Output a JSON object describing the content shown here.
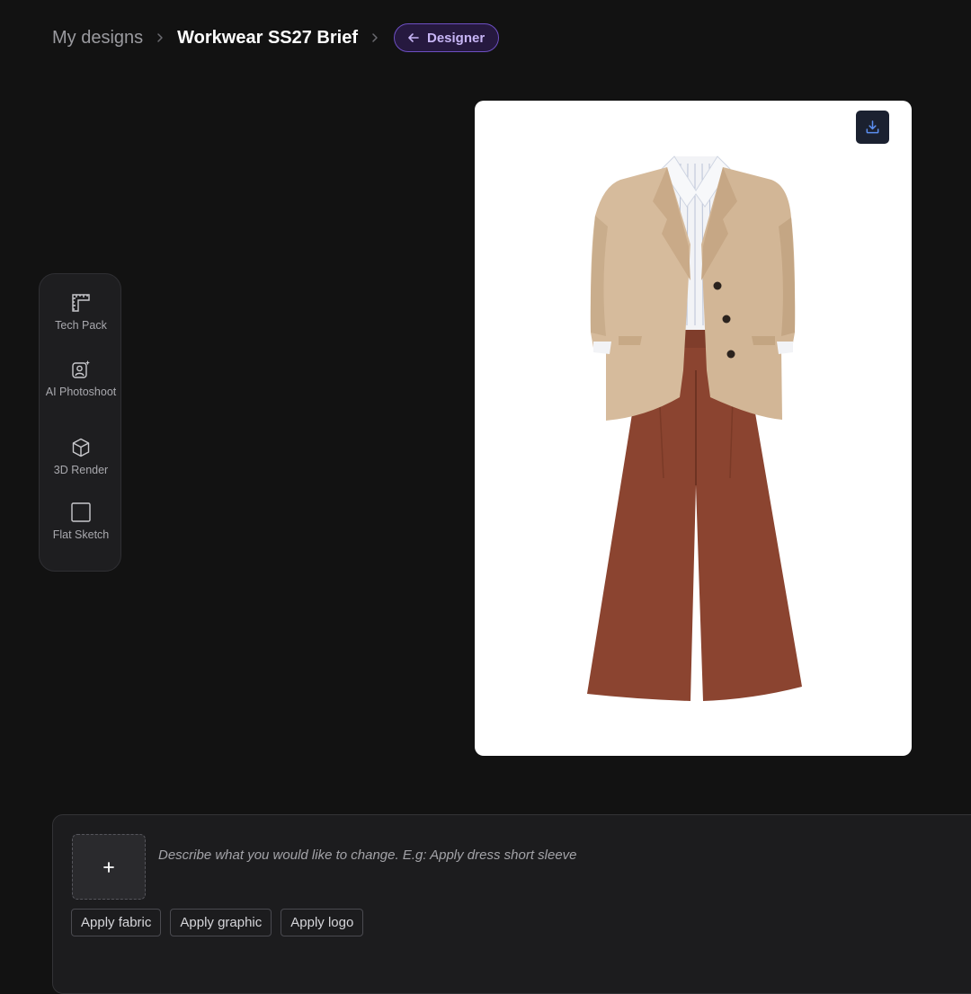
{
  "breadcrumb": {
    "home": "My designs",
    "current": "Workwear SS27 Brief",
    "mode_button": "Designer",
    "separator_icon": "chevron-right-icon",
    "mode_icon": "arrow-left-icon"
  },
  "tools": [
    {
      "label": "Tech Pack",
      "icon": "ruler-square-icon"
    },
    {
      "label": "AI Photoshoot",
      "icon": "ai-portrait-icon"
    },
    {
      "label": "3D Render",
      "icon": "cube-icon"
    },
    {
      "label": "Flat Sketch",
      "icon": "square-outline-icon"
    }
  ],
  "preview": {
    "download_icon": "download-icon",
    "image_subject": "beige-blazer-striped-shirt-rust-trousers",
    "colors": {
      "blazer": "#d6bb9c",
      "shirt": "#f2f3f6",
      "trousers": "#8b4430",
      "buttons": "#2b231e"
    }
  },
  "prompt": {
    "placeholder": "Describe what you would like to change. E.g: Apply dress short sleeve",
    "value": "",
    "upload_icon": "plus-icon",
    "chips": [
      "Apply fabric",
      "Apply graphic",
      "Apply logo"
    ]
  },
  "colors": {
    "background": "#121212",
    "accent": "#6d4fc2",
    "accent_text": "#c7b5f5",
    "panel": "#1c1c1e"
  }
}
